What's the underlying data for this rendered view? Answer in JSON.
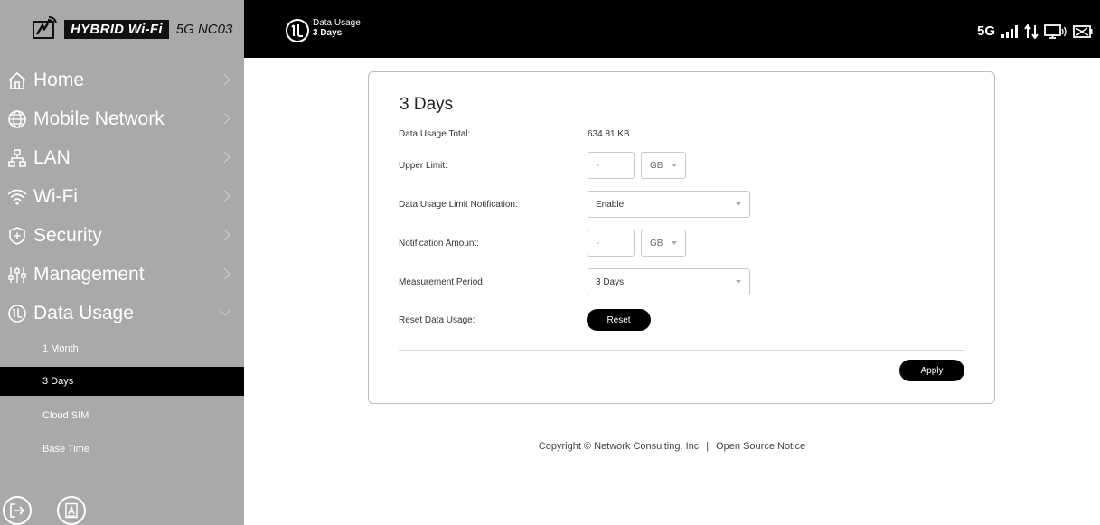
{
  "brand": {
    "hybrid_label": "HYBRID Wi-Fi",
    "model": "5G NC03"
  },
  "header": {
    "section_title": "Data Usage",
    "page_title": "3 Days",
    "network_type": "5G"
  },
  "sidebar": {
    "items": [
      {
        "label": "Home",
        "icon": "home-icon"
      },
      {
        "label": "Mobile Network",
        "icon": "globe-icon"
      },
      {
        "label": "LAN",
        "icon": "lan-icon"
      },
      {
        "label": "Wi-Fi",
        "icon": "wifi-icon"
      },
      {
        "label": "Security",
        "icon": "shield-icon"
      },
      {
        "label": "Management",
        "icon": "sliders-icon"
      },
      {
        "label": "Data Usage",
        "icon": "data-usage-icon"
      }
    ],
    "subitems": [
      {
        "label": "1 Month"
      },
      {
        "label": "3 Days",
        "active": true
      },
      {
        "label": "Cloud SIM"
      },
      {
        "label": "Base Time"
      }
    ]
  },
  "main": {
    "title": "3 Days",
    "labels": {
      "total": "Data Usage Total:",
      "upper_limit": "Upper Limit:",
      "notification": "Data Usage Limit Notification:",
      "notification_amount": "Notification Amount:",
      "period": "Measurement Period:",
      "reset": "Reset Data Usage:"
    },
    "values": {
      "total": "634.81 KB",
      "upper_limit": "-",
      "upper_limit_unit": "GB",
      "notification": "Enable",
      "notification_amount": "-",
      "notification_amount_unit": "GB",
      "period": "3 Days"
    },
    "buttons": {
      "reset": "Reset",
      "apply": "Apply"
    }
  },
  "footer": {
    "copyright": "Copyright © Network Consulting, Inc",
    "separator": "|",
    "open_source": "Open Source Notice"
  }
}
